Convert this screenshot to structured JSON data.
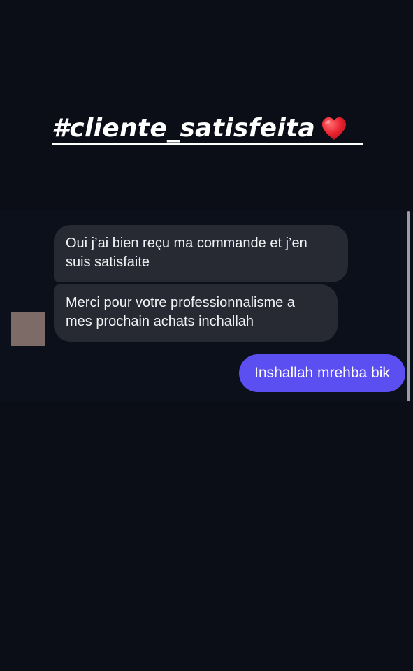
{
  "story": {
    "caption": "#cliente_satisfeita",
    "caption_emoji": "heart-icon",
    "caption_color": "#ffffff",
    "heart_color": "#e8232f"
  },
  "chat": {
    "background": "#0c101a",
    "incoming_bubble_color": "#272a33",
    "outgoing_bubble_color": "#5b4ff2",
    "avatar_color": "#7d6b68",
    "messages": [
      {
        "direction": "incoming",
        "text": "Oui j’ai bien reçu ma commande et j’en suis satisfaite"
      },
      {
        "direction": "incoming",
        "text": "Merci pour votre professionnalisme a mes prochain achats inchallah"
      },
      {
        "direction": "outgoing",
        "text": "Inshallah mrehba bik"
      }
    ]
  }
}
